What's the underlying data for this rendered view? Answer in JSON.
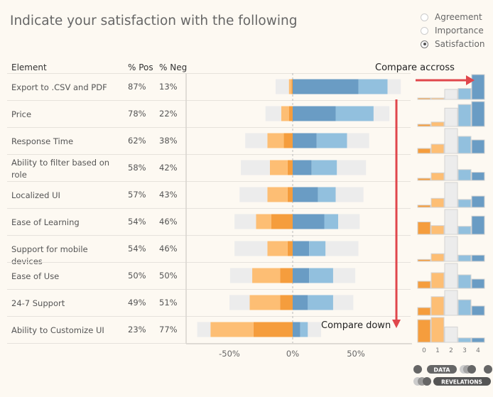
{
  "title": "Indicate your satisfaction with the following",
  "filter": {
    "options": [
      "Agreement",
      "Importance",
      "Satisfaction"
    ],
    "selected": "Satisfaction"
  },
  "table": {
    "headers": {
      "element": "Element",
      "pos": "% Pos",
      "neg": "% Neg"
    }
  },
  "annotations": {
    "across": "Compare accross",
    "down": "Compare down",
    "arrow_color": "#e0474c"
  },
  "colors": {
    "strong_neg": "#f59d3d",
    "neg": "#fdbe74",
    "neutral": "#ececec",
    "pos": "#92c0de",
    "strong_pos": "#6a9cc4"
  },
  "chart_data": {
    "type": "bar",
    "subtype": "diverging-stacked",
    "categories": [
      "Export to .CSV and PDF",
      "Price",
      "Response Time",
      "Ability to filter based on role",
      "Localized UI",
      "Ease of Learning",
      "Support for mobile devices",
      "Ease of Use",
      "24-7 Support",
      "Ability to Customize UI"
    ],
    "pct_pos": [
      "87%",
      "78%",
      "62%",
      "58%",
      "57%",
      "54%",
      "54%",
      "50%",
      "49%",
      "23%"
    ],
    "pct_neg": [
      "13%",
      "22%",
      "38%",
      "42%",
      "43%",
      "46%",
      "46%",
      "50%",
      "51%",
      "77%"
    ],
    "segments": [
      "0",
      "1",
      "2",
      "3",
      "4"
    ],
    "values": [
      [
        1,
        2,
        21,
        23,
        52
      ],
      [
        3,
        6,
        25,
        30,
        34
      ],
      [
        7,
        13,
        35,
        24,
        19
      ],
      [
        4,
        14,
        46,
        20,
        15
      ],
      [
        4,
        16,
        44,
        14,
        20
      ],
      [
        17,
        12,
        34,
        11,
        25
      ],
      [
        4,
        16,
        52,
        13,
        13
      ],
      [
        10,
        22,
        35,
        19,
        13
      ],
      [
        10,
        24,
        32,
        20,
        12
      ],
      [
        31,
        34,
        21,
        6,
        6
      ]
    ],
    "xlim": [
      -75,
      85
    ],
    "xticks": [
      "-50%",
      "0%",
      "50%"
    ],
    "xtick_values": [
      -50,
      0,
      50
    ],
    "hist_ticks": [
      "0",
      "1",
      "2",
      "3",
      "4"
    ]
  },
  "logo": {
    "top": "DATA",
    "bottom": "REVELATIONS"
  }
}
